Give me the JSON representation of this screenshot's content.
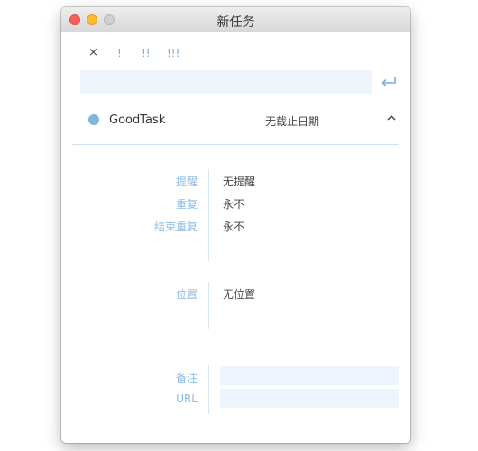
{
  "window": {
    "title": "新任务"
  },
  "priority": {
    "none": "×",
    "low": "!",
    "medium": "!!",
    "high": "!!!"
  },
  "task": {
    "title_value": "",
    "title_placeholder": ""
  },
  "list": {
    "name": "GoodTask",
    "color": "#7eb6df"
  },
  "due": {
    "label": "无截止日期"
  },
  "alerts": {
    "reminder_label": "提醒",
    "reminder_value": "无提醒",
    "repeat_label": "重复",
    "repeat_value": "永不",
    "end_repeat_label": "结束重复",
    "end_repeat_value": "永不"
  },
  "location": {
    "label": "位置",
    "value": "无位置"
  },
  "notes": {
    "label": "备注",
    "value": ""
  },
  "url": {
    "label": "URL",
    "value": ""
  },
  "icons": {
    "return": "return-icon",
    "chevron": "chevron-up-icon"
  },
  "colors": {
    "accent": "#8ebde3",
    "field_bg": "#eef4fb"
  }
}
